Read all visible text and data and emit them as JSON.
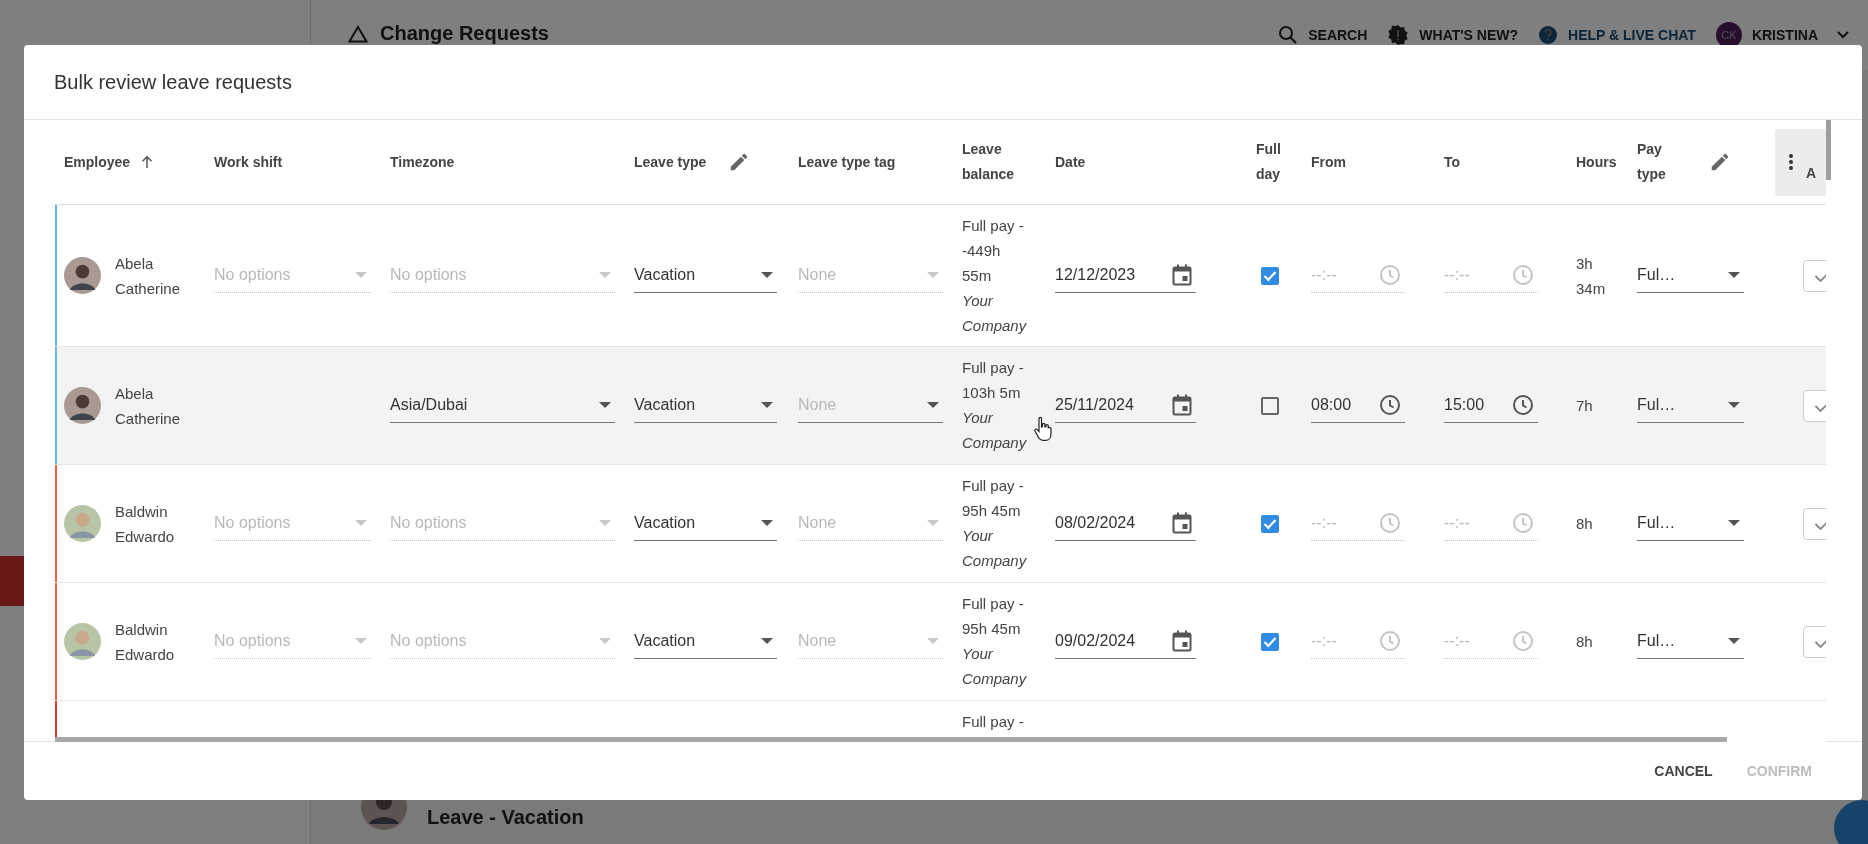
{
  "app_header": {
    "title": "Change Requests",
    "actions": [
      {
        "kind": "search",
        "label": "SEARCH"
      },
      {
        "kind": "news",
        "label": "WHAT'S NEW?"
      },
      {
        "kind": "help",
        "label": "HELP & LIVE CHAT"
      }
    ],
    "user": {
      "initials": "CK",
      "name": "KRISTINA"
    }
  },
  "background_item": {
    "title": "Leave - Vacation"
  },
  "dialog": {
    "title": "Bulk review leave requests",
    "columns": [
      {
        "label": "Employee",
        "sorted_ascending": true
      },
      {
        "label": "Work shift"
      },
      {
        "label": "Timezone"
      },
      {
        "label": "Leave type",
        "editable": true
      },
      {
        "label": "Leave type tag"
      },
      {
        "label": "Leave balance"
      },
      {
        "label": "Date"
      },
      {
        "label": "Full day"
      },
      {
        "label": "From"
      },
      {
        "label": "To"
      },
      {
        "label": "Hours"
      },
      {
        "label": "Pay type",
        "editable": true
      },
      {
        "label": "A",
        "menu": true
      }
    ],
    "rows": [
      {
        "color": "#64b5f6",
        "highlighted": false,
        "employee": "Abela Catherine",
        "work_shift": {
          "placeholder": "No options",
          "disabled": true
        },
        "timezone": {
          "placeholder": "No options",
          "disabled": true
        },
        "leave_type": {
          "value": "Vacation",
          "disabled": false
        },
        "leave_type_tag": {
          "placeholder": "None",
          "disabled": true
        },
        "balance": "Full pay - -449h 55m",
        "company": "Your Company",
        "date": "12/12/2023",
        "full_day": true,
        "from": {
          "placeholder": "--:--",
          "disabled": true
        },
        "to": {
          "placeholder": "--:--",
          "disabled": true
        },
        "hours": "3h 34m",
        "pay_type": {
          "value": "Ful…",
          "disabled": false
        }
      },
      {
        "color": "#64b5f6",
        "highlighted": true,
        "employee": "Abela Catherine",
        "timezone": {
          "value": "Asia/Dubai",
          "disabled": false
        },
        "leave_type": {
          "value": "Vacation",
          "disabled": false
        },
        "leave_type_tag": {
          "placeholder": "None",
          "disabled": false
        },
        "balance": "Full pay - 103h 5m",
        "company": "Your Company",
        "date": "25/11/2024",
        "full_day": false,
        "from": {
          "value": "08:00",
          "disabled": false
        },
        "to": {
          "value": "15:00",
          "disabled": false
        },
        "hours": "7h",
        "pay_type": {
          "value": "Ful…",
          "disabled": false
        }
      },
      {
        "color": "#e8603c",
        "highlighted": false,
        "employee": "Baldwin Edwardo",
        "work_shift": {
          "placeholder": "No options",
          "disabled": true
        },
        "timezone": {
          "placeholder": "No options",
          "disabled": true
        },
        "leave_type": {
          "value": "Vacation",
          "disabled": false
        },
        "leave_type_tag": {
          "placeholder": "None",
          "disabled": true
        },
        "balance": "Full pay - 95h 45m",
        "company": "Your Company",
        "date": "08/02/2024",
        "full_day": true,
        "from": {
          "placeholder": "--:--",
          "disabled": true
        },
        "to": {
          "placeholder": "--:--",
          "disabled": true
        },
        "hours": "8h",
        "pay_type": {
          "value": "Ful…",
          "disabled": false
        }
      },
      {
        "color": "#e8603c",
        "highlighted": false,
        "employee": "Baldwin Edwardo",
        "work_shift": {
          "placeholder": "No options",
          "disabled": true
        },
        "timezone": {
          "placeholder": "No options",
          "disabled": true
        },
        "leave_type": {
          "value": "Vacation",
          "disabled": false
        },
        "leave_type_tag": {
          "placeholder": "None",
          "disabled": true
        },
        "balance": "Full pay - 95h 45m",
        "company": "Your Company",
        "date": "09/02/2024",
        "full_day": true,
        "from": {
          "placeholder": "--:--",
          "disabled": true
        },
        "to": {
          "placeholder": "--:--",
          "disabled": true
        },
        "hours": "8h",
        "pay_type": {
          "value": "Ful…",
          "disabled": false
        }
      },
      {
        "color": "#e53935",
        "highlighted": false,
        "balance": "Full pay -"
      }
    ],
    "buttons": [
      {
        "label": "CANCEL",
        "disabled": false
      },
      {
        "label": "CONFIRM",
        "disabled": true
      }
    ]
  }
}
